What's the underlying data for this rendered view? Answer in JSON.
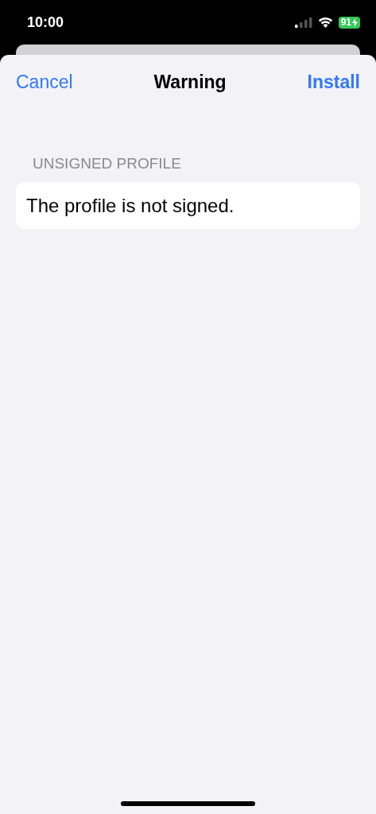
{
  "status_bar": {
    "time": "10:00",
    "battery": "91"
  },
  "nav": {
    "cancel": "Cancel",
    "title": "Warning",
    "install": "Install"
  },
  "section": {
    "header": "UNSIGNED PROFILE",
    "text": "The profile is not signed."
  }
}
